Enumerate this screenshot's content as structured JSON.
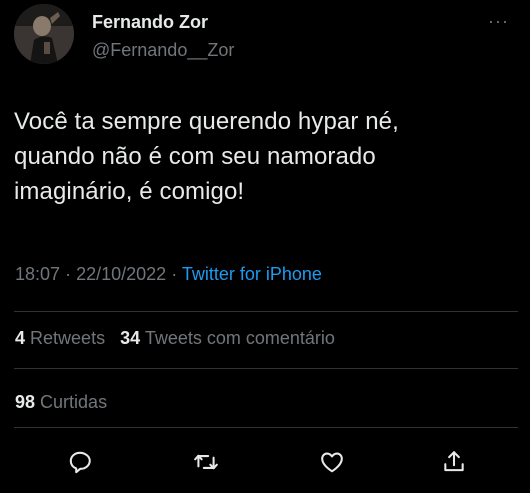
{
  "author": {
    "name": "Fernando Zor",
    "handle": "@Fernando__Zor",
    "avatar_icon": "avatar-photo"
  },
  "more_icon": "more-options-icon",
  "more_label": "···",
  "tweet": {
    "text": "Você ta sempre querendo hypar né,\nquando não é com seu namorado\nimaginário, é comigo!",
    "time": "18:07",
    "separator": "·",
    "date": "22/10/2022",
    "source": "Twitter for iPhone"
  },
  "stats": {
    "retweets_count": "4",
    "retweets_label": "Retweets",
    "quotes_count": "34",
    "quotes_label": "Tweets com comentário",
    "likes_count": "98",
    "likes_label": "Curtidas"
  },
  "actions": [
    {
      "icon": "reply-icon"
    },
    {
      "icon": "retweet-icon"
    },
    {
      "icon": "like-icon"
    },
    {
      "icon": "share-icon"
    }
  ],
  "colors": {
    "background": "#000000",
    "text": "#e7e9ea",
    "muted": "#71767b",
    "link": "#1d9bf0",
    "divider": "#2f3336"
  }
}
